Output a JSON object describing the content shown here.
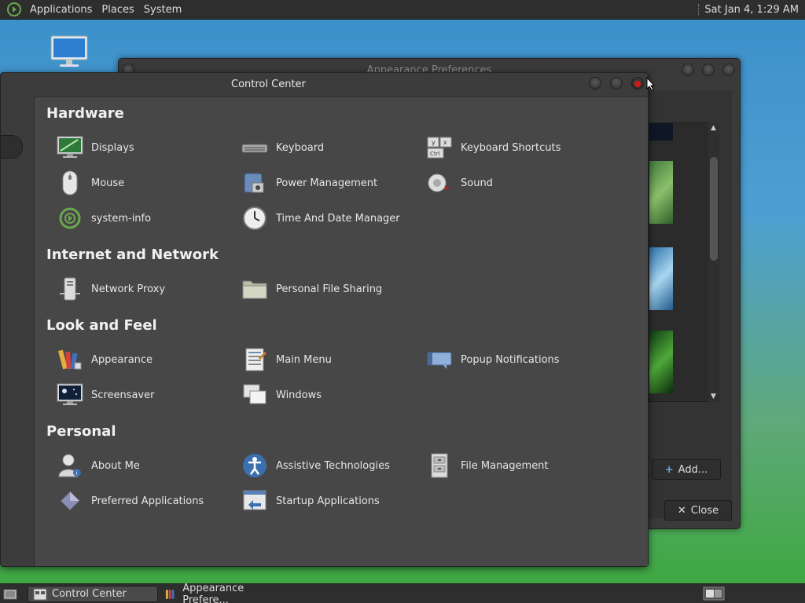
{
  "top_panel": {
    "menus": [
      "Applications",
      "Places",
      "System"
    ],
    "clock": "Sat Jan  4,  1:29 AM"
  },
  "appearance_window": {
    "title": "Appearance Preferences",
    "add_label": "Add...",
    "close_label": "Close"
  },
  "control_center": {
    "title": "Control Center",
    "sections": [
      {
        "title": "Hardware",
        "items": [
          {
            "label": "Displays",
            "icon": "display-icon"
          },
          {
            "label": "Keyboard",
            "icon": "keyboard-icon"
          },
          {
            "label": "Keyboard Shortcuts",
            "icon": "keyboard-shortcuts-icon"
          },
          {
            "label": "Mouse",
            "icon": "mouse-icon"
          },
          {
            "label": "Power Management",
            "icon": "power-management-icon"
          },
          {
            "label": "Sound",
            "icon": "sound-icon"
          },
          {
            "label": "system-info",
            "icon": "system-info-icon"
          },
          {
            "label": "Time And Date Manager",
            "icon": "clock-icon"
          }
        ]
      },
      {
        "title": "Internet and Network",
        "items": [
          {
            "label": "Network Proxy",
            "icon": "network-proxy-icon"
          },
          {
            "label": "Personal File Sharing",
            "icon": "folder-share-icon"
          }
        ]
      },
      {
        "title": "Look and Feel",
        "items": [
          {
            "label": "Appearance",
            "icon": "appearance-icon"
          },
          {
            "label": "Main Menu",
            "icon": "main-menu-icon"
          },
          {
            "label": "Popup Notifications",
            "icon": "notification-icon"
          },
          {
            "label": "Screensaver",
            "icon": "screensaver-icon"
          },
          {
            "label": "Windows",
            "icon": "windows-icon"
          }
        ]
      },
      {
        "title": "Personal",
        "items": [
          {
            "label": "About Me",
            "icon": "about-me-icon"
          },
          {
            "label": "Assistive Technologies",
            "icon": "accessibility-icon"
          },
          {
            "label": "File Management",
            "icon": "file-management-icon"
          },
          {
            "label": "Preferred Applications",
            "icon": "preferred-apps-icon"
          },
          {
            "label": "Startup Applications",
            "icon": "startup-apps-icon"
          }
        ]
      }
    ]
  },
  "taskbar": {
    "tasks": [
      "Control Center",
      "Appearance Prefere..."
    ]
  },
  "colors": {
    "panel": "#2e2e2e",
    "window_bg": "#474747",
    "close_red": "#d01a1a"
  }
}
